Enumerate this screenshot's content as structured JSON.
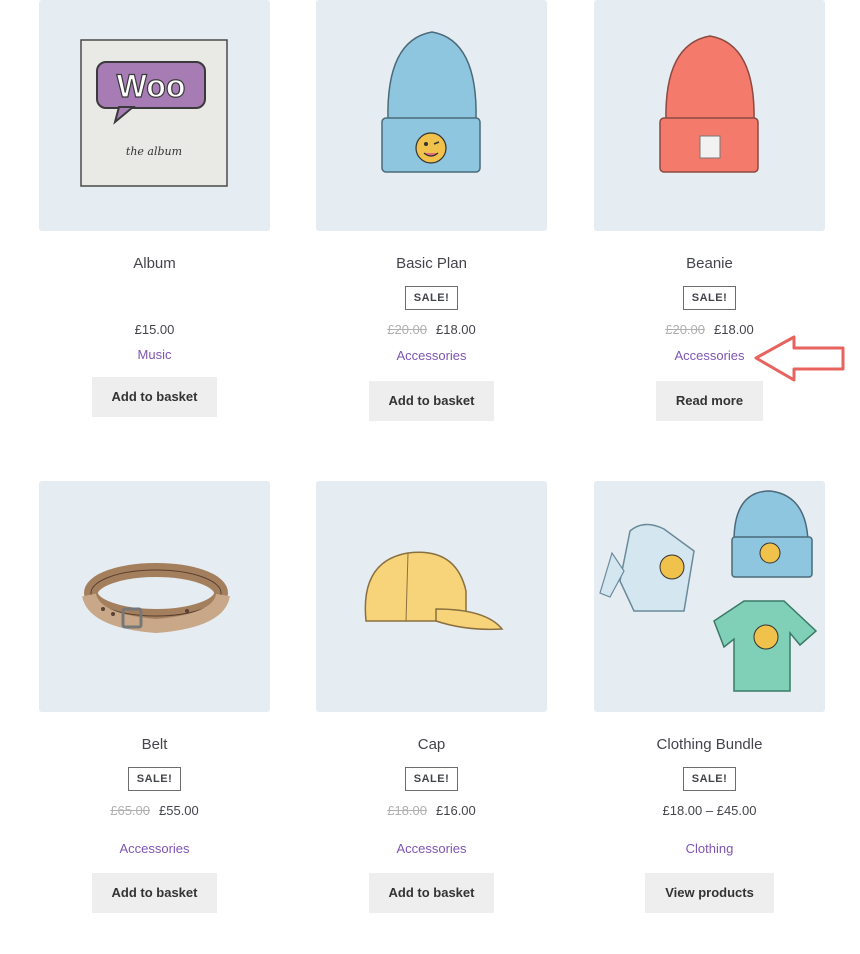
{
  "products": [
    {
      "title": "Album",
      "price": "£15.00",
      "category": "Music",
      "button": "Add to basket"
    },
    {
      "title": "Basic Plan",
      "badge": "SALE!",
      "old_price": "£20.00",
      "price": "£18.00",
      "category": "Accessories",
      "button": "Add to basket"
    },
    {
      "title": "Beanie",
      "badge": "SALE!",
      "old_price": "£20.00",
      "price": "£18.00",
      "category": "Accessories",
      "button": "Read more"
    },
    {
      "title": "Belt",
      "badge": "SALE!",
      "old_price": "£65.00",
      "price": "£55.00",
      "category": "Accessories",
      "button": "Add to basket"
    },
    {
      "title": "Cap",
      "badge": "SALE!",
      "old_price": "£18.00",
      "price": "£16.00",
      "category": "Accessories",
      "button": "Add to basket"
    },
    {
      "title": "Clothing Bundle",
      "badge": "SALE!",
      "price": "£18.00 – £45.00",
      "category": "Clothing",
      "button": "View products"
    }
  ],
  "album_art": {
    "logo": "Woo",
    "subtitle": "the album"
  },
  "colors": {
    "link": "#7f54b3",
    "thumb_bg": "#e6edf2",
    "arrow": "#e8625e"
  }
}
